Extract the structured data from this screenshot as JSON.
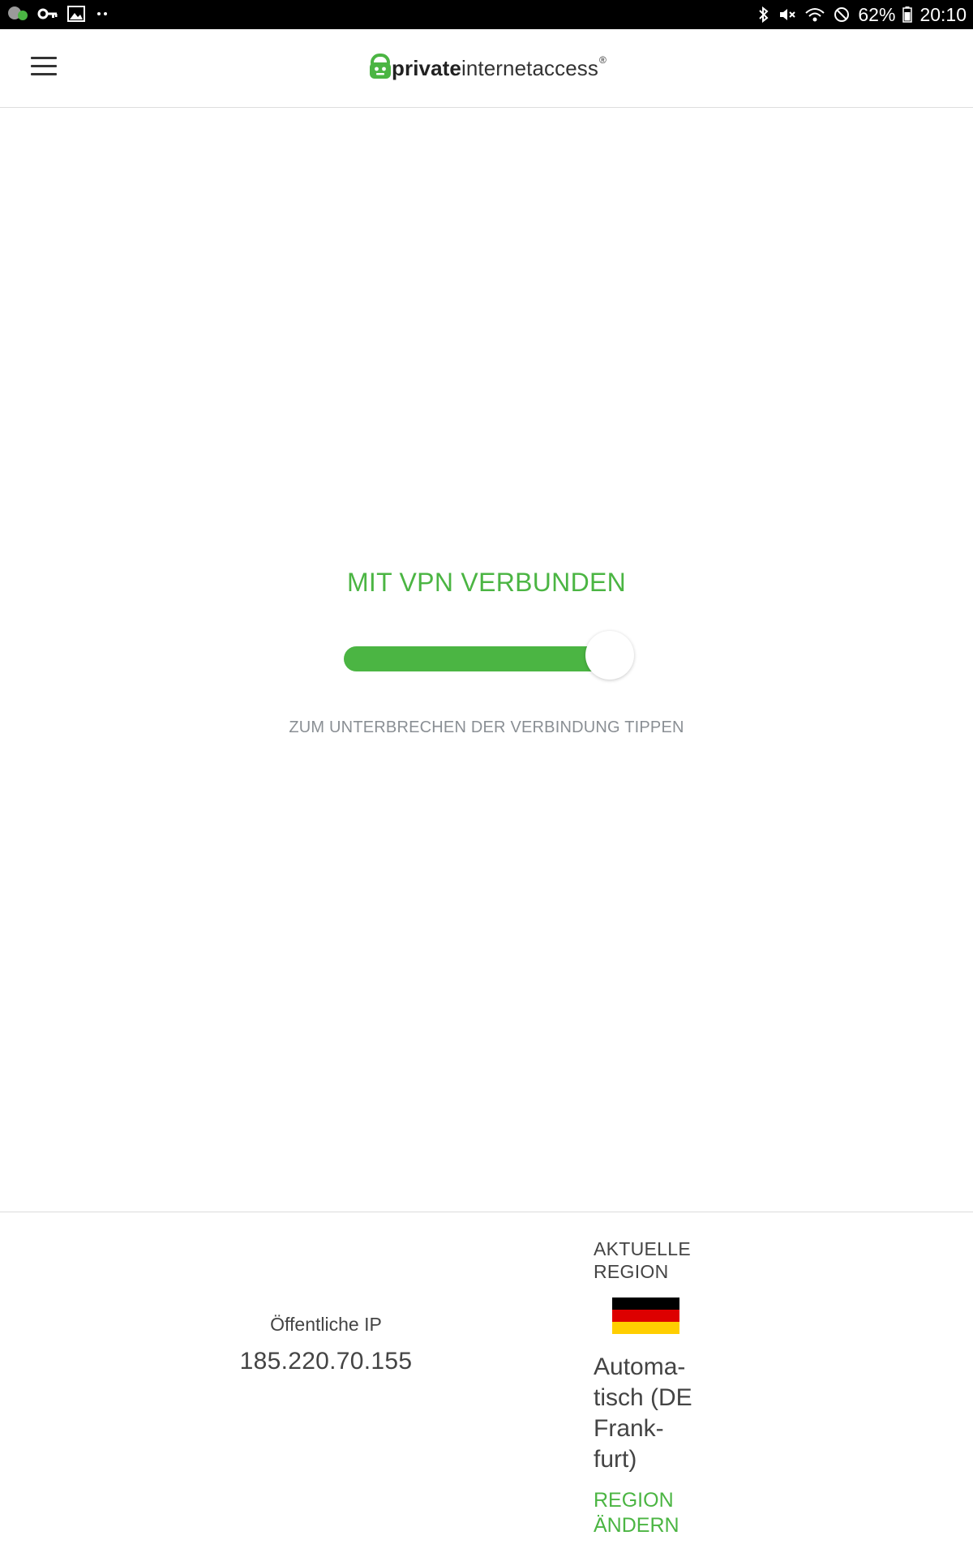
{
  "status_bar": {
    "battery": "62%",
    "time": "20:10"
  },
  "header": {
    "logo_bold": "private",
    "logo_regular": "internetaccess",
    "logo_mark": "®"
  },
  "main": {
    "status_title": "MIT VPN VERBUNDEN",
    "toggle_state": "on",
    "status_hint": "ZUM UNTERBRECHEN DER VERBINDUNG TIPPEN"
  },
  "footer": {
    "ip_label": "Öffentliche IP",
    "ip_value": "185.220.70.155",
    "region_label_line1": "AKTUELLE",
    "region_label_line2": "REGION",
    "region_name_lines": [
      "Automa-",
      "tisch (DE",
      "Frank-",
      "furt)"
    ],
    "change_region_line1": "REGION",
    "change_region_line2": "ÄNDERN"
  },
  "colors": {
    "accent": "#4bb543",
    "text": "#444444",
    "hint": "#8a8f94"
  },
  "icons": [
    "chat-bubble-icon",
    "vpn-key-icon",
    "image-icon",
    "more-dots-icon",
    "bluetooth-icon",
    "mute-icon",
    "wifi-icon",
    "blocked-icon",
    "battery-icon",
    "menu-icon",
    "pia-logo-icon",
    "germany-flag-icon"
  ]
}
